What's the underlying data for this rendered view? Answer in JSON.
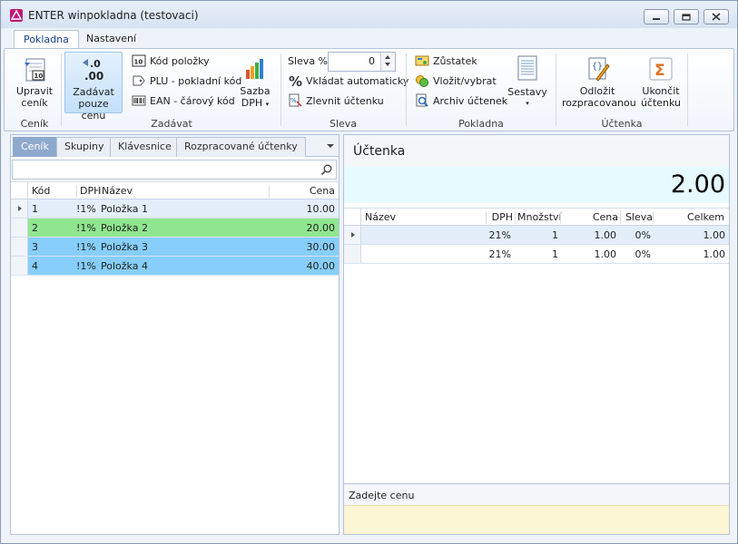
{
  "window": {
    "title": "ENTER winpokladna (testovaci)"
  },
  "ribbon_tabs": [
    "Pokladna",
    "Nastavení"
  ],
  "groups": {
    "cenik": "Ceník",
    "zadavat": "Zadávat",
    "sleva": "Sleva",
    "pokladna": "Pokladna",
    "uctenka": "Účtenka"
  },
  "buttons": {
    "upravit_l1": "Upravit",
    "upravit_l2": "ceník",
    "zadavat_l1": "Zadávat",
    "zadavat_l2": "pouze cenu",
    "kod_polozky": "Kód položky",
    "plu": "PLU - pokladní kód",
    "ean": "EAN - čárový kód",
    "sazba_l1": "Sazba",
    "sazba_l2": "DPH",
    "sleva_pct": "Sleva %",
    "sleva_value": "0",
    "vkladat": "Vkládat automaticky",
    "zlevnit": "Zlevnit účtenku",
    "zustatek": "Zůstatek",
    "vlozit": "Vložit/vybrat",
    "archiv": "Archiv účtenek",
    "sestavy": "Sestavy",
    "odlozit_l1": "Odložit",
    "odlozit_l2": "rozpracovanou",
    "ukoncit_l1": "Ukončit",
    "ukoncit_l2": "účtenku"
  },
  "left_tabs": [
    "Ceník",
    "Skupiny",
    "Klávesnice",
    "Rozpracované účtenky"
  ],
  "price_list": {
    "headers": {
      "kod": "Kód",
      "dph": "DPH",
      "nazev": "Název",
      "cena": "Cena"
    },
    "rows": [
      {
        "kod": "1",
        "dph": "!1%",
        "nazev": "Položka 1",
        "cena": "10.00",
        "color": "#e3eefa"
      },
      {
        "kod": "2",
        "dph": "!1%",
        "nazev": "Položka 2",
        "cena": "20.00",
        "color": "#90e690"
      },
      {
        "kod": "3",
        "dph": "!1%",
        "nazev": "Položka 3",
        "cena": "30.00",
        "color": "#87cefa"
      },
      {
        "kod": "4",
        "dph": "!1%",
        "nazev": "Položka 4",
        "cena": "40.00",
        "color": "#87cefa"
      }
    ]
  },
  "receipt": {
    "title": "Účtenka",
    "total": "2.00",
    "headers": {
      "nazev": "Název",
      "dph": "DPH",
      "mnozstvi": "Množství",
      "cena": "Cena",
      "sleva": "Sleva",
      "celkem": "Celkem"
    },
    "rows": [
      {
        "nazev": "",
        "dph": "21%",
        "mnozstvi": "1",
        "cena": "1.00",
        "sleva": "0%",
        "celkem": "1.00",
        "color": "#e3eefa"
      },
      {
        "nazev": "",
        "dph": "21%",
        "mnozstvi": "1",
        "cena": "1.00",
        "sleva": "0%",
        "celkem": "1.00",
        "color": "#ffffff"
      }
    ]
  },
  "prompt": {
    "label": "Zadejte cenu"
  }
}
